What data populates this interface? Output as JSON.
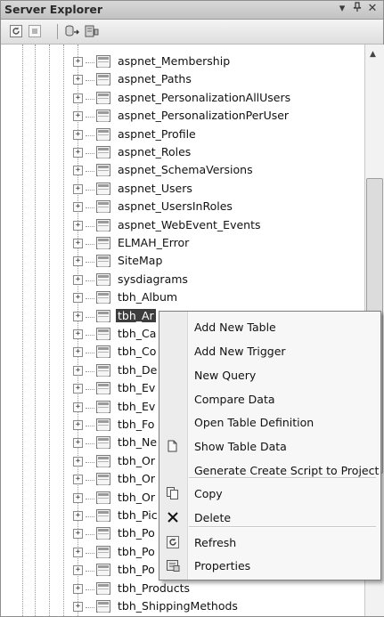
{
  "window": {
    "title": "Server Explorer",
    "pin_icon": "pin-icon",
    "close_icon": "close-icon"
  },
  "toolbar": {
    "icons": [
      "refresh-icon",
      "stop-refresh-icon",
      "connect-to-database-icon",
      "connect-to-server-icon"
    ]
  },
  "tree": {
    "items": [
      {
        "label": "aspnet_Membership"
      },
      {
        "label": "aspnet_Paths"
      },
      {
        "label": "aspnet_PersonalizationAllUsers"
      },
      {
        "label": "aspnet_PersonalizationPerUser"
      },
      {
        "label": "aspnet_Profile"
      },
      {
        "label": "aspnet_Roles"
      },
      {
        "label": "aspnet_SchemaVersions"
      },
      {
        "label": "aspnet_Users"
      },
      {
        "label": "aspnet_UsersInRoles"
      },
      {
        "label": "aspnet_WebEvent_Events"
      },
      {
        "label": "ELMAH_Error"
      },
      {
        "label": "SiteMap"
      },
      {
        "label": "sysdiagrams"
      },
      {
        "label": "tbh_Album"
      },
      {
        "label": "tbh_Ar",
        "selected": true
      },
      {
        "label": "tbh_Ca"
      },
      {
        "label": "tbh_Co"
      },
      {
        "label": "tbh_De"
      },
      {
        "label": "tbh_Ev"
      },
      {
        "label": "tbh_Ev"
      },
      {
        "label": "tbh_Fo"
      },
      {
        "label": "tbh_Ne"
      },
      {
        "label": "tbh_Or"
      },
      {
        "label": "tbh_Or"
      },
      {
        "label": "tbh_Or"
      },
      {
        "label": "tbh_Pic"
      },
      {
        "label": "tbh_Po"
      },
      {
        "label": "tbh_Po"
      },
      {
        "label": "tbh_Po"
      },
      {
        "label": "tbh_Products"
      },
      {
        "label": "tbh_ShippingMethods"
      }
    ]
  },
  "context_menu": {
    "items": [
      {
        "label": "Add New Table",
        "icon": ""
      },
      {
        "label": "Add New Trigger",
        "icon": ""
      },
      {
        "label": "New Query",
        "icon": ""
      },
      {
        "label": "Compare Data",
        "icon": ""
      },
      {
        "label": "Open Table Definition",
        "icon": ""
      },
      {
        "label": "Show Table Data",
        "icon": "show-table-data-icon"
      },
      {
        "label": "Generate Create Script to Project",
        "icon": ""
      },
      {
        "label": "Copy",
        "icon": "copy-icon"
      },
      {
        "label": "Delete",
        "icon": "delete-icon"
      },
      {
        "label": "Refresh",
        "icon": "refresh-icon"
      },
      {
        "label": "Properties",
        "icon": "properties-icon"
      }
    ]
  }
}
